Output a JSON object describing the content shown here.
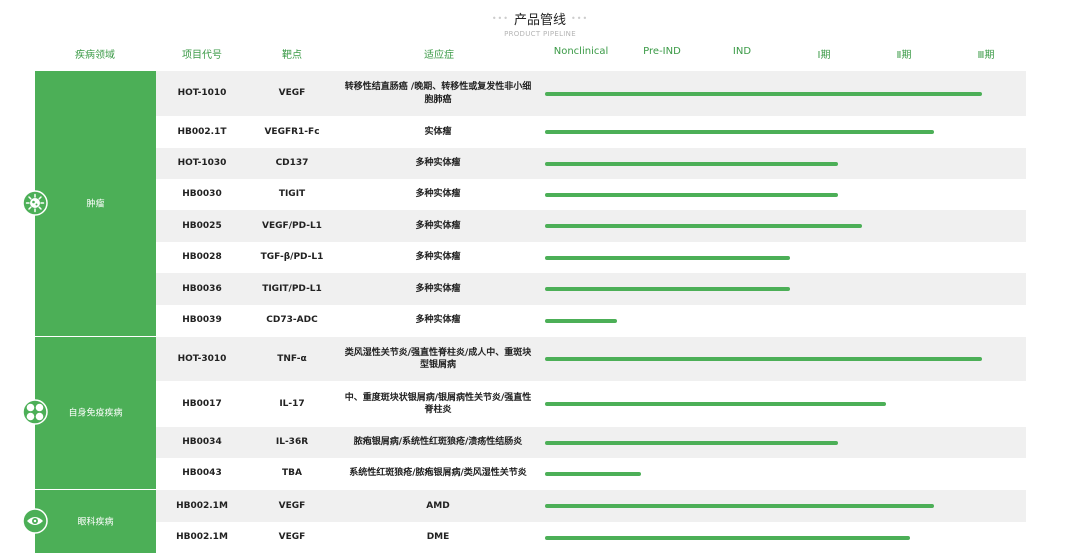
{
  "header": {
    "title": "产品管线",
    "title_dots_left": "•••",
    "title_dots_right": "•••",
    "subtitle": "PRODUCT PIPELINE"
  },
  "columns": {
    "disease_area": "疾病领域",
    "project_code": "项目代号",
    "target": "靶点",
    "indication": "适应症",
    "stages": [
      "Nonclinical",
      "Pre-IND",
      "IND",
      "Ⅰ期",
      "Ⅱ期",
      "Ⅲ期"
    ]
  },
  "categories": [
    {
      "label": "肿瘤",
      "icon": "virus-icon"
    },
    {
      "label": "自身免疫疾病",
      "icon": "clover-icon"
    },
    {
      "label": "眼科疾病",
      "icon": "eye-icon"
    }
  ],
  "rows": [
    {
      "code": "HOT-1010",
      "target": "VEGF",
      "indication": "转移性结直肠癌 /晚期、转移性或复发性非小细胞肺癌",
      "progress": 0.91
    },
    {
      "code": "HB002.1T",
      "target": "VEGFR1-Fc",
      "indication": "实体瘤",
      "progress": 0.81
    },
    {
      "code": "HOT-1030",
      "target": "CD137",
      "indication": "多种实体瘤",
      "progress": 0.61
    },
    {
      "code": "HB0030",
      "target": "TIGIT",
      "indication": "多种实体瘤",
      "progress": 0.61
    },
    {
      "code": "HB0025",
      "target": "VEGF/PD-L1",
      "indication": "多种实体瘤",
      "progress": 0.66
    },
    {
      "code": "HB0028",
      "target": "TGF-β/PD-L1",
      "indication": "多种实体瘤",
      "progress": 0.51
    },
    {
      "code": "HB0036",
      "target": "TIGIT/PD-L1",
      "indication": "多种实体瘤",
      "progress": 0.51
    },
    {
      "code": "HB0039",
      "target": "CD73-ADC",
      "indication": "多种实体瘤",
      "progress": 0.15
    },
    {
      "code": "HOT-3010",
      "target": "TNF-α",
      "indication": "类风湿性关节炎/强直性脊柱炎/成人中、重斑块型银屑病",
      "progress": 0.91
    },
    {
      "code": "HB0017",
      "target": "IL-17",
      "indication": "中、重度斑块状银屑病/银屑病性关节炎/强直性脊柱炎",
      "progress": 0.71
    },
    {
      "code": "HB0034",
      "target": "IL-36R",
      "indication": "脓疱银屑病/系统性红斑狼疮/溃疡性结肠炎",
      "progress": 0.61
    },
    {
      "code": "HB0043",
      "target": "TBA",
      "indication": "系统性红斑狼疮/脓疱银屑病/类风湿性关节炎",
      "progress": 0.2
    },
    {
      "code": "HB002.1M",
      "target": "VEGF",
      "indication": "AMD",
      "progress": 0.81
    },
    {
      "code": "HB002.1M",
      "target": "VEGF",
      "indication": "DME",
      "progress": 0.76
    }
  ],
  "colors": {
    "accent": "#4caf57",
    "header_text": "#3a9a46",
    "row_shade": "#f0f0f0"
  }
}
